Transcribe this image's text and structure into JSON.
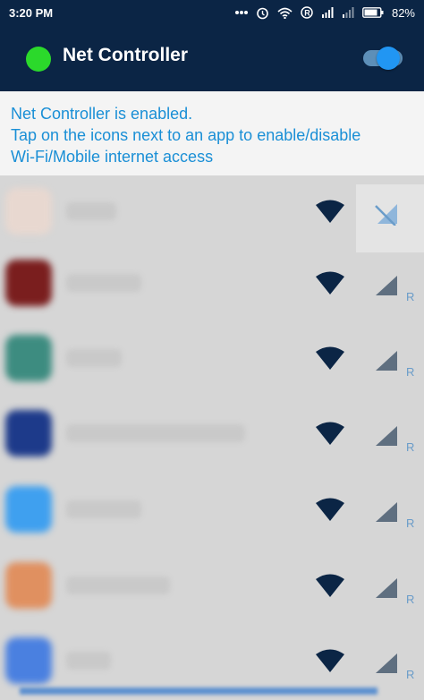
{
  "status": {
    "time": "3:20 PM",
    "battery": "82%",
    "icons": [
      "notification-dots-icon",
      "alarm-icon",
      "wifi-status-icon",
      "roaming-icon",
      "signal-icon",
      "signal-icon-2",
      "battery-icon"
    ]
  },
  "app": {
    "title": "Net Controller",
    "enabled_dot_color": "#2bd92b",
    "master_toggle_on": true,
    "accent": "#2196f3",
    "header_color": "#0b2545"
  },
  "info": {
    "line1": "Net Controller is enabled.",
    "line2": "Tap on the icons next to an app to enable/disable",
    "line3": "Wi-Fi/Mobile internet access"
  },
  "apps": [
    {
      "icon_color": "#e8d8d0",
      "wifi": "allowed",
      "mobile": "blocked",
      "mobile_label": ""
    },
    {
      "icon_color": "#7a1e1e",
      "wifi": "allowed",
      "mobile": "allowed",
      "mobile_label": "R"
    },
    {
      "icon_color": "#3d8c80",
      "wifi": "allowed",
      "mobile": "allowed",
      "mobile_label": "R"
    },
    {
      "icon_color": "#1d3a8a",
      "wifi": "allowed",
      "mobile": "allowed",
      "mobile_label": "R"
    },
    {
      "icon_color": "#3fa0ef",
      "wifi": "allowed",
      "mobile": "allowed",
      "mobile_label": "R"
    },
    {
      "icon_color": "#e09060",
      "wifi": "allowed",
      "mobile": "allowed",
      "mobile_label": "R"
    },
    {
      "icon_color": "#4a80e0",
      "wifi": "allowed",
      "mobile": "allowed",
      "mobile_label": "R"
    }
  ]
}
